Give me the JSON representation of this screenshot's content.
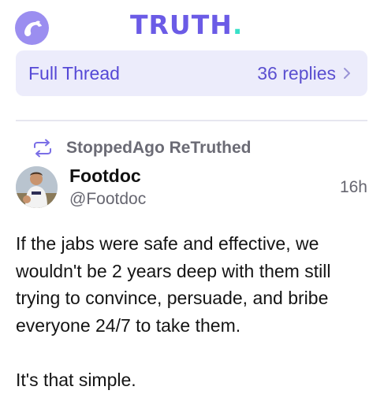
{
  "header": {
    "logo_text": "TRUTH",
    "logo_dot": ".",
    "avatar_icon": "eagle-icon",
    "brand_color": "#6b5be6",
    "accent_color": "#37e0c8"
  },
  "thread_bar": {
    "label": "Full Thread",
    "replies": "36 replies",
    "chevron_icon": "chevron-right-icon"
  },
  "retruth": {
    "icon": "retruth-icon",
    "text": "StoppedAgo ReTruthed"
  },
  "post": {
    "author_name": "Footdoc",
    "author_handle": "@Footdoc",
    "time": "16h",
    "paragraph_1": "If the jabs were safe and effective, we\nwouldn't be 2 years deep with them still\ntrying to convince, persuade, and bribe\neveryone 24/7 to take them.",
    "paragraph_2": "It's that simple."
  }
}
